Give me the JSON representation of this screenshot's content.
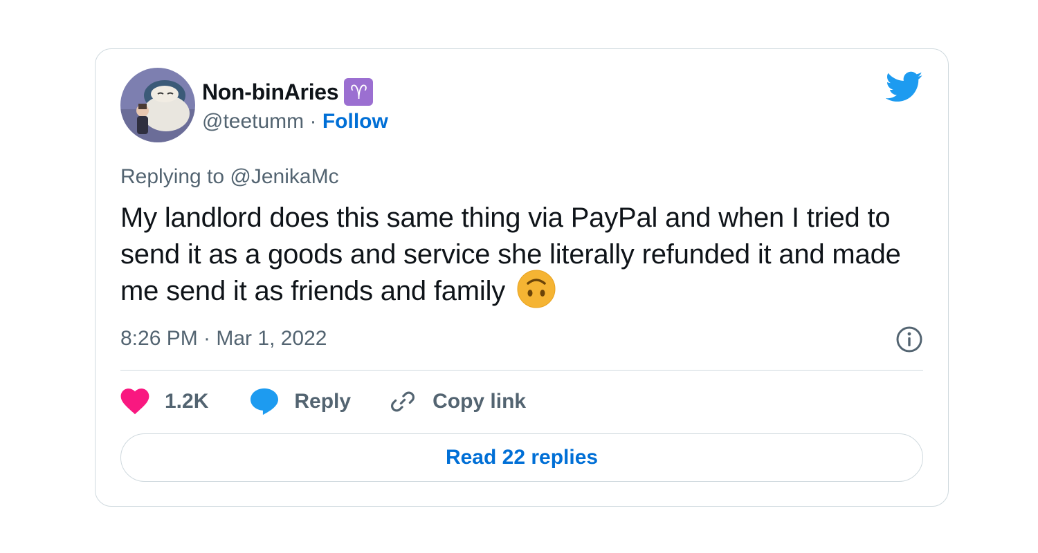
{
  "tweet": {
    "author": {
      "display_name": "Non-binAries",
      "badge_emoji": "♈",
      "handle": "@teetumm",
      "separator": "·",
      "follow_label": "Follow"
    },
    "replying_to": "Replying to @JenikaMc",
    "text": "My landlord does this same thing via PayPal and when I tried to send it as a goods and service she literally refunded it and made me send it as friends and family",
    "emoji_end": "upside-down-face",
    "timestamp": "8:26 PM · Mar 1, 2022",
    "actions": {
      "likes_count": "1.2K",
      "reply_label": "Reply",
      "copy_link_label": "Copy link"
    },
    "read_replies_label": "Read 22 replies"
  },
  "icons": {
    "brand": "twitter-bird-icon",
    "info": "info-icon",
    "like": "heart-icon",
    "reply": "speech-bubble-icon",
    "copy": "link-icon"
  },
  "colors": {
    "brand_blue": "#1d9bf0",
    "link_blue": "#006fd6",
    "heart": "#f91880",
    "muted": "#536471",
    "border": "#cfd9de",
    "badge_purple": "#9b6fd1"
  }
}
